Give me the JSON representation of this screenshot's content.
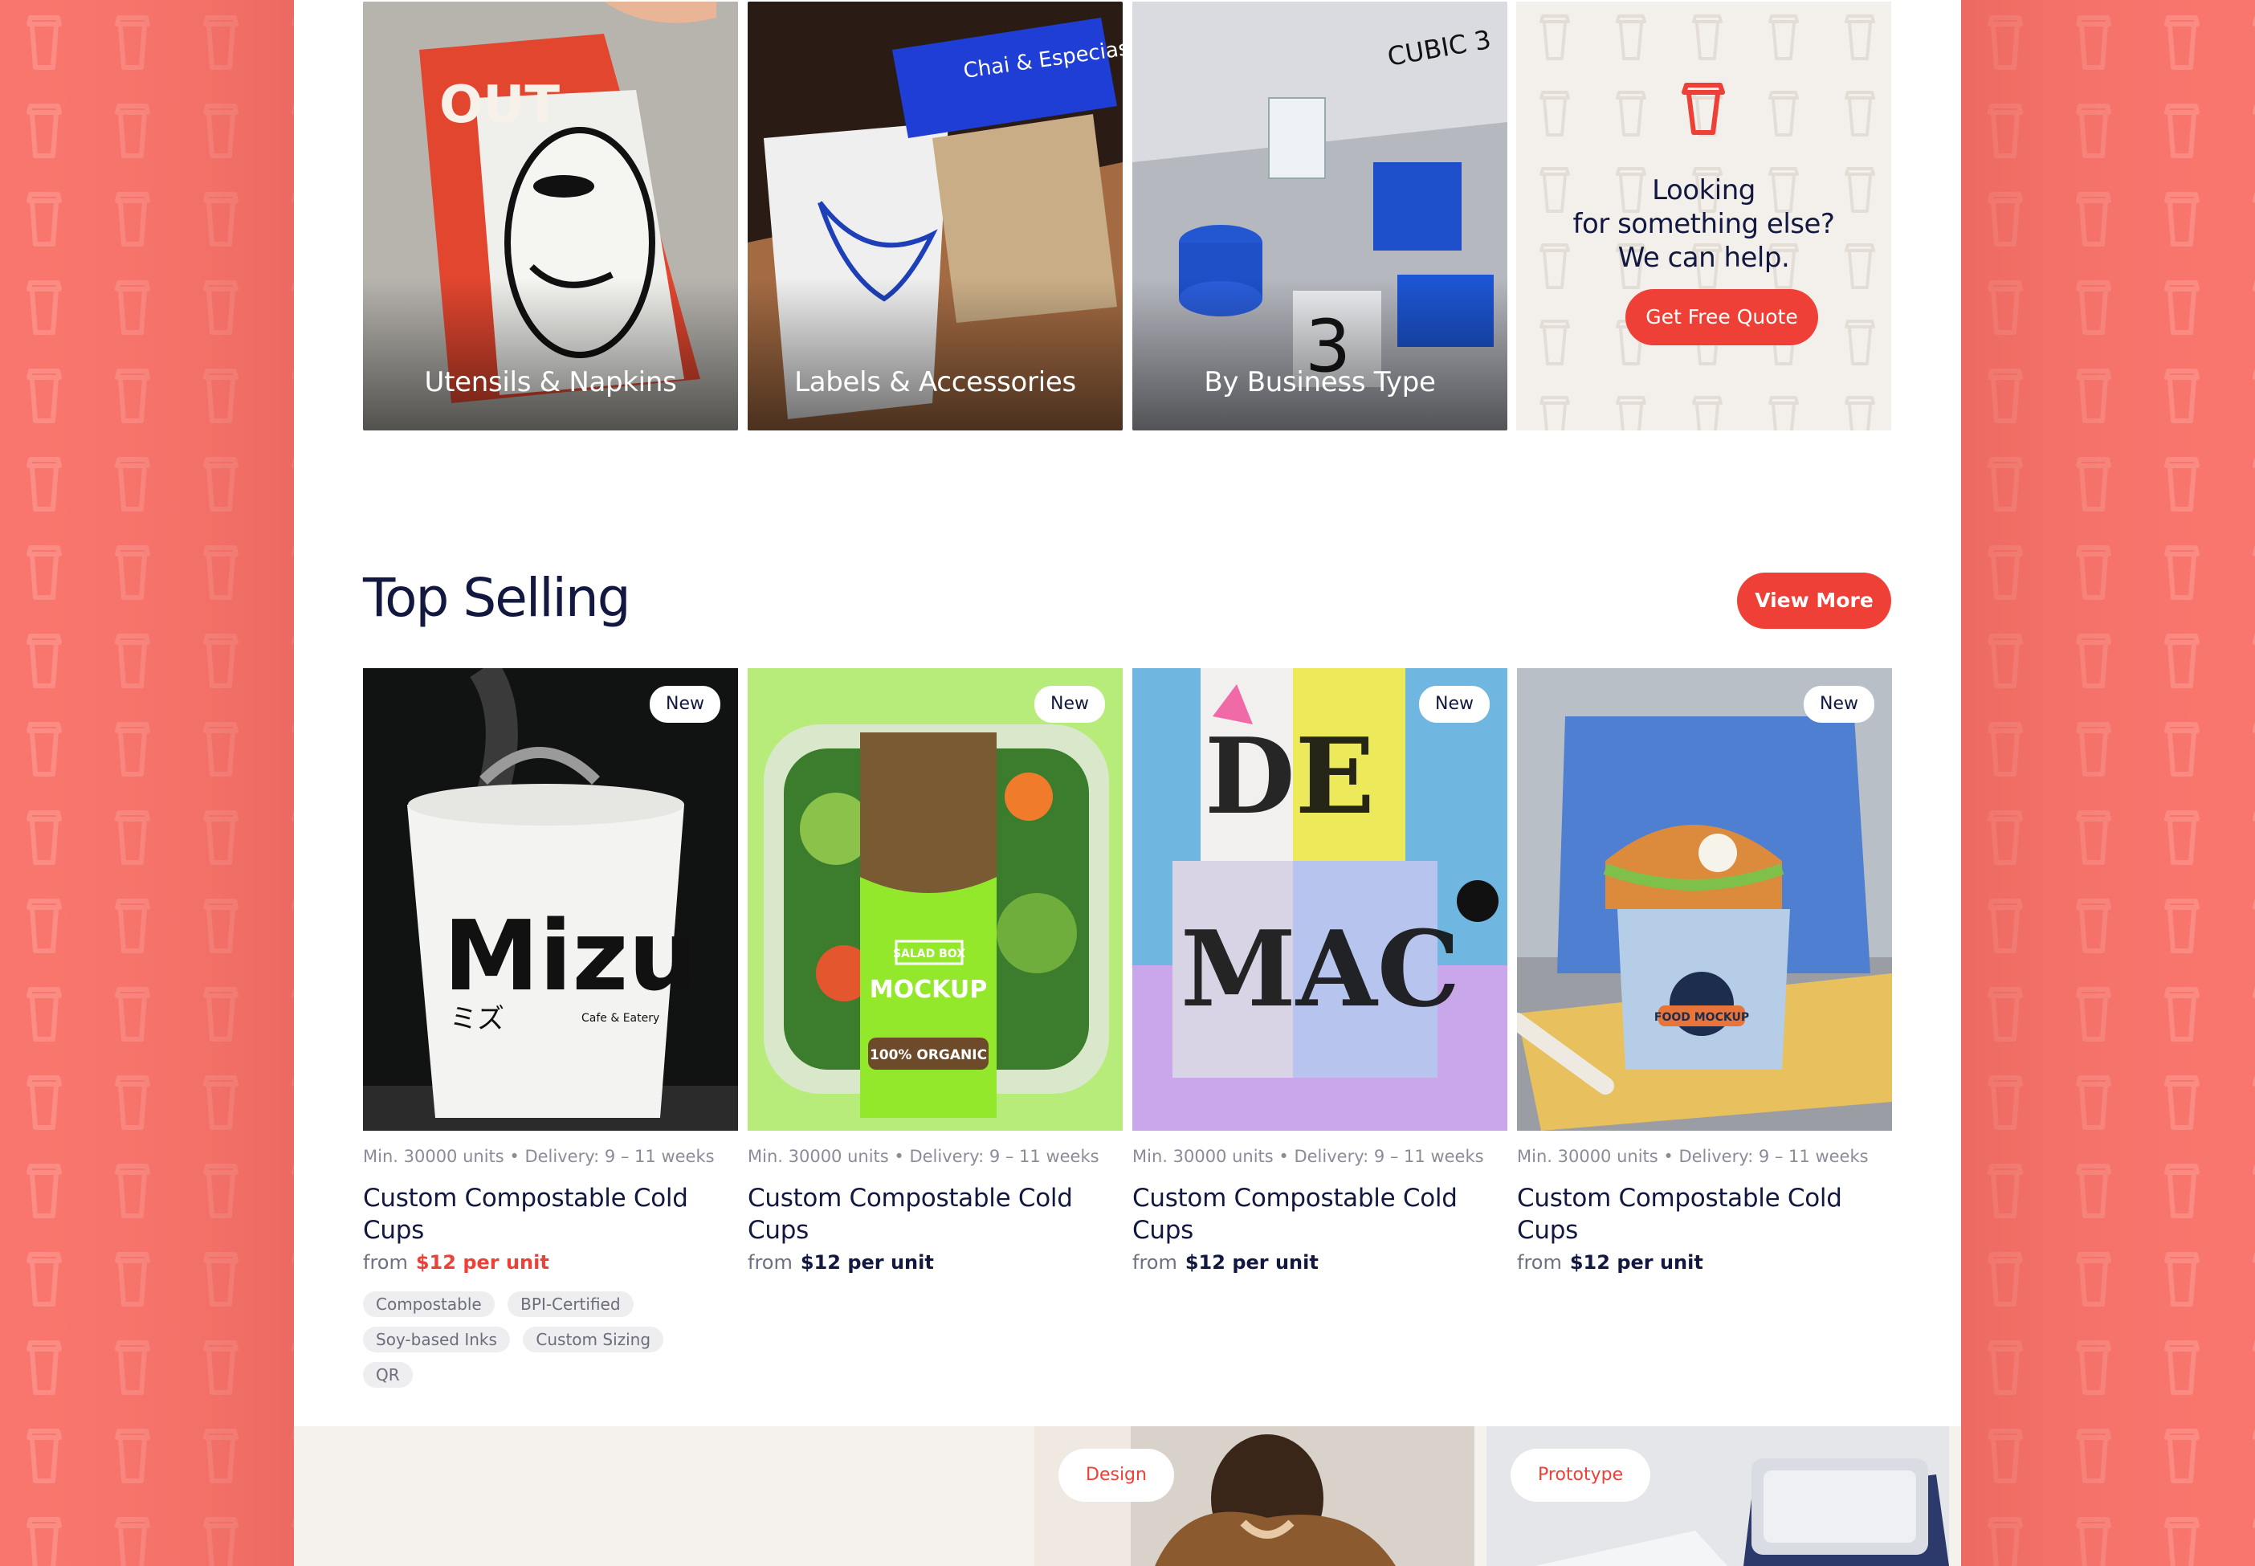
{
  "colors": {
    "brand": "#ee4036",
    "navy": "#121840",
    "page_bg": "#f8766d",
    "muted": "#8a8c99"
  },
  "categories": [
    {
      "label": "Utensils & Napkins"
    },
    {
      "label": "Labels & Accessories"
    },
    {
      "label": "By Business Type"
    }
  ],
  "help_card": {
    "icon": "cup-icon",
    "line1": "Looking",
    "line2": "for something else?",
    "line3": "We can help.",
    "cta": "Get Free Quote"
  },
  "top_selling": {
    "title": "Top Selling",
    "view_more": "View More",
    "products": [
      {
        "badge": "New",
        "meta": "Min. 30000 units • Delivery: 9 – 11 weeks",
        "title": "Custom Compostable Cold Cups",
        "price_prefix": "from",
        "price": "$12 per unit",
        "tags": [
          "Compostable",
          "BPI-Certified",
          "Soy-based Inks",
          "Custom Sizing",
          "QR"
        ]
      },
      {
        "badge": "New",
        "meta": "Min. 30000 units • Delivery: 9 – 11 weeks",
        "title": "Custom Compostable Cold Cups",
        "price_prefix": "from",
        "price": "$12 per unit"
      },
      {
        "badge": "New",
        "meta": "Min. 30000 units • Delivery: 9 – 11 weeks",
        "title": "Custom Compostable Cold Cups",
        "price_prefix": "from",
        "price": "$12 per unit"
      },
      {
        "badge": "New",
        "meta": "Min. 30000 units • Delivery: 9 – 11 weeks",
        "title": "Custom Compostable Cold Cups",
        "price_prefix": "from",
        "price": "$12 per unit"
      }
    ]
  },
  "image_text": {
    "cup1_brand": "Mizu",
    "cup1_sub": "ミズ",
    "cup1_tag": "Cafe & Eatery",
    "salad_box": "SALAD BOX",
    "salad_mockup": "MOCKUP",
    "salad_organic": "100% ORGANIC",
    "food_mockup": "FOOD MOCKUP",
    "cubic": "CUBIC 3",
    "chai": "Chai & Especias."
  },
  "bottom_cards": [
    {
      "pill": "Design"
    },
    {
      "pill": "Prototype"
    }
  ]
}
